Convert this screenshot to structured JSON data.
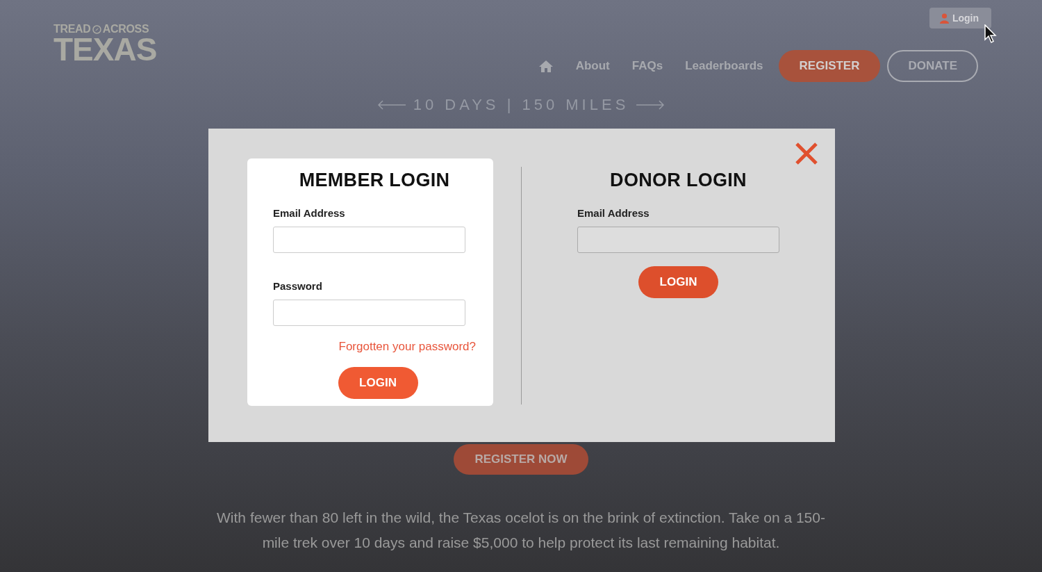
{
  "logo": {
    "word_left": "TREAD",
    "word_right": "ACROSS",
    "word_main": "TEXAS"
  },
  "nav": {
    "links": [
      {
        "label": "About"
      },
      {
        "label": "FAQs"
      },
      {
        "label": "Leaderboards"
      }
    ],
    "register": "REGISTER",
    "donate": "DONATE"
  },
  "account": {
    "login": "Login"
  },
  "hero": {
    "tagline": "10 DAYS | 150 MILES",
    "cta": "REGISTER NOW",
    "description": "With fewer than 80 left in the wild, the Texas ocelot is on the brink of extinction. Take on a 150-mile trek over 10 days and raise $5,000 to help protect its last remaining habitat."
  },
  "modal": {
    "member": {
      "title": "MEMBER LOGIN",
      "email_label": "Email Address",
      "password_label": "Password",
      "forgot": "Forgotten your password?",
      "button": "LOGIN"
    },
    "donor": {
      "title": "DONOR LOGIN",
      "email_label": "Email Address",
      "button": "LOGIN"
    }
  }
}
